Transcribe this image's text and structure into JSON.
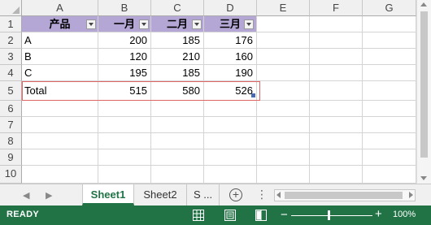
{
  "columns": [
    "A",
    "B",
    "C",
    "D",
    "E",
    "F",
    "G"
  ],
  "rows": [
    "1",
    "2",
    "3",
    "4",
    "5",
    "6",
    "7",
    "8",
    "9",
    "10"
  ],
  "table": {
    "headers": [
      "产品",
      "一月",
      "二月",
      "三月"
    ],
    "data": [
      [
        "A",
        "200",
        "185",
        "176"
      ],
      [
        "B",
        "120",
        "210",
        "160"
      ],
      [
        "C",
        "195",
        "185",
        "190"
      ],
      [
        "Total",
        "515",
        "580",
        "526"
      ]
    ],
    "header_color": "#b4a7d6"
  },
  "sheets": {
    "tabs": [
      "Sheet1",
      "Sheet2",
      "S ..."
    ],
    "active": "Sheet1",
    "add_label": "+",
    "more_label": "⋮",
    "prev_label": "◀",
    "next_label": "▶"
  },
  "status": {
    "text": "READY",
    "zoom": "100%",
    "zoom_minus": "−",
    "zoom_plus": "+",
    "bar_color": "#217346"
  },
  "icons": {
    "normal_view": "grid-view-icon",
    "page_layout": "page-layout-icon",
    "page_break": "page-break-preview-icon",
    "filter": "filter-dropdown-icon"
  }
}
